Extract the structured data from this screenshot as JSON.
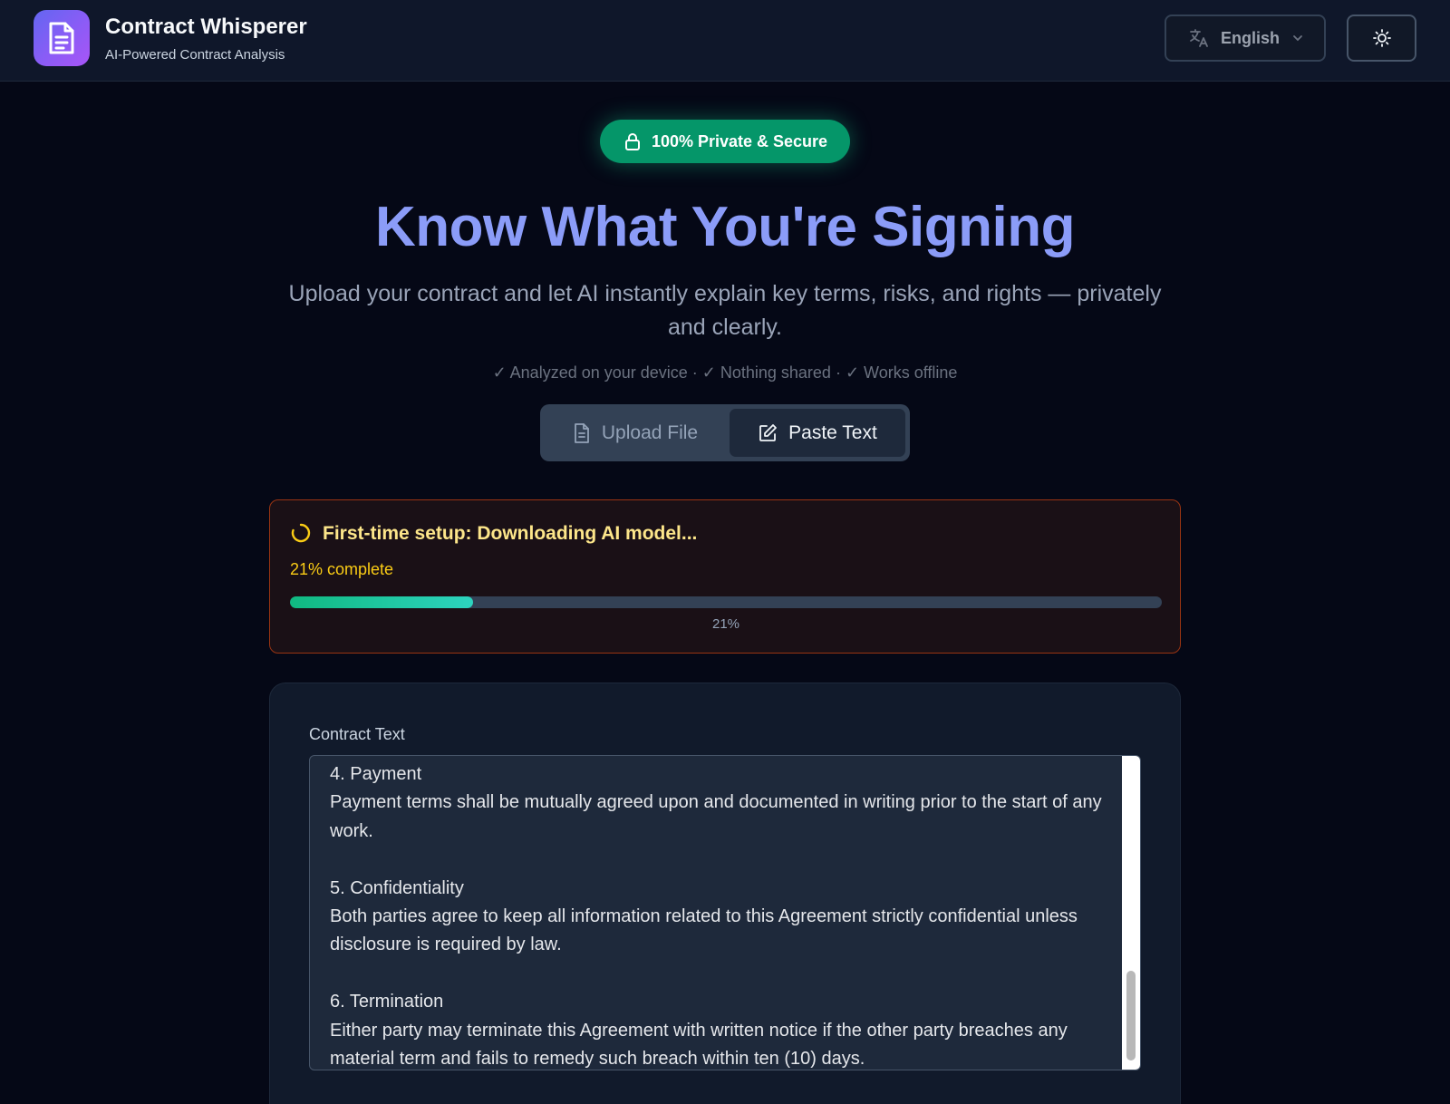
{
  "header": {
    "title": "Contract Whisperer",
    "subtitle": "AI-Powered Contract Analysis",
    "language": "English",
    "logo_icon": "document-icon",
    "theme_icon": "sun-icon"
  },
  "hero": {
    "badge": "100% Private & Secure",
    "title": "Know What You're Signing",
    "description": "Upload your contract and let AI instantly explain key terms, risks, and rights — privately and clearly.",
    "checks": "✓ Analyzed on your device · ✓ Nothing shared · ✓ Works offline"
  },
  "mode_tabs": [
    {
      "label": "Upload File",
      "icon": "file-icon",
      "active": false
    },
    {
      "label": "Paste Text",
      "icon": "edit-icon",
      "active": true
    }
  ],
  "setup": {
    "title": "First-time setup: Downloading AI model...",
    "status": "21% complete",
    "progress": 0.21,
    "progress_label": "21%"
  },
  "contract": {
    "label": "Contract Text",
    "text": "4. Payment\nPayment terms shall be mutually agreed upon and documented in writing prior to the start of any work.\n\n5. Confidentiality\nBoth parties agree to keep all information related to this Agreement strictly confidential unless disclosure is required by law.\n\n6. Termination\nEither party may terminate this Agreement with written notice if the other party breaches any material term and fails to remedy such breach within ten (10) days."
  },
  "colors": {
    "accent": "#8b9cf8",
    "badge": "#059669",
    "progress": "#10b981",
    "warning": "#facc15"
  }
}
